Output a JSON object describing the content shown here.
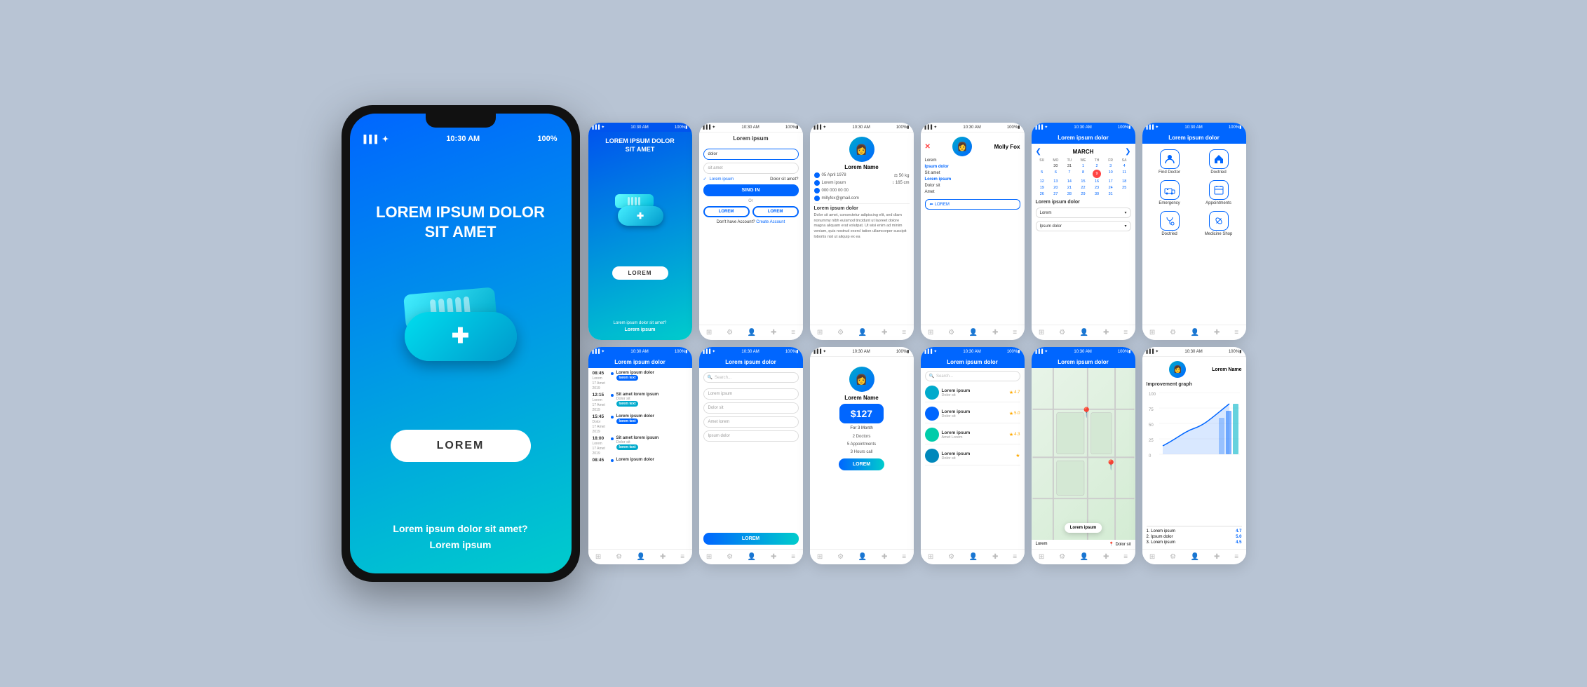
{
  "bg": "#b8c4d4",
  "bigPhone": {
    "status": {
      "signal": "▌▌▌",
      "wifi": "wifi",
      "time": "10:30 AM",
      "battery": "100%"
    },
    "title": "LOREM IPSUM DOLOR\nSIT AMET",
    "button": "LOREM",
    "footer": "Lorem ipsum dolor sit amet?",
    "footerLink": "Lorem ipsum"
  },
  "phones": [
    {
      "id": "phone1",
      "type": "splash",
      "statusTime": "10:30 AM",
      "statusBattery": "100%",
      "title": "LOREM IPSUM DOLOR SIT AMET",
      "button": "LOREM",
      "footer": "Lorem ipsum dolor sit amet?",
      "footerLink": "Lorem ipsum"
    },
    {
      "id": "phone2",
      "type": "login",
      "statusTime": "10:30 AM",
      "headerTitle": "Lorem ipsum",
      "inputs": [
        "dolor",
        "sit amet"
      ],
      "checkLabel": "Lorem ipsum",
      "checkRight": "Dolor sit amet?",
      "signinBtn": "SING IN",
      "or": "Or",
      "socialBtns": [
        "LOREM",
        "LOREM"
      ],
      "footerText": "Don't have Account?",
      "footerLink": "Create Account"
    },
    {
      "id": "phone3",
      "type": "profile",
      "statusTime": "10:30 AM",
      "name": "Lorem Name",
      "dob": "05 April 1978",
      "weight": "50 kg",
      "height": "165 cm",
      "phone": "000 000 00 00",
      "email": "millyfox@gmail.com",
      "sectionTitle": "Lorem ipsum dolor",
      "desc": "Dolor sit amet, consectetur adipiscing elit, sed diam nonummy nibh euismod tincidunt ut laoreet dolore magna aliquam erat volutpat. Ut wisi enim ad minim veniam, quis nostrud exercl tation ullamcorper suscipit lobortis nisl ut aliquip ex ea"
    },
    {
      "id": "phone4",
      "type": "chat",
      "statusTime": "10:30 AM",
      "name": "Molly Fox",
      "items": [
        "Lorem",
        "Ipsum dolor",
        "Sit amet",
        "Lorem ipsum",
        "Dolor sit",
        "Amet"
      ],
      "logoutLabel": "LOREM"
    },
    {
      "id": "phone5",
      "type": "calendar",
      "statusTime": "10:30 AM",
      "headerTitle": "Lorem ipsum dolor",
      "month": "MARCH",
      "days": [
        "SU",
        "MO",
        "TU",
        "WE",
        "TH",
        "FR",
        "SA"
      ],
      "dates": [
        [
          "",
          "30",
          "31",
          "1",
          "2",
          "3",
          "4",
          "5"
        ],
        [
          "6",
          "7",
          "8",
          "9",
          "10",
          "11",
          "12"
        ],
        [
          "13",
          "14",
          "15",
          "16",
          "17",
          "18",
          "19"
        ],
        [
          "20",
          "21",
          "22",
          "23",
          "24",
          "25",
          "26"
        ],
        [
          "27",
          "28",
          "29",
          "30",
          "31",
          "",
          ""
        ]
      ],
      "today": "9",
      "dropdown1": "Lorem",
      "dropdown2": "Ipsum dolor",
      "sectionTitle": "Lorem ipsum dolor"
    },
    {
      "id": "phone6",
      "type": "icons",
      "statusTime": "10:30 AM",
      "headerTitle": "Lorem ipsum dolor",
      "icons": [
        {
          "icon": "👨‍⚕️",
          "label": "Find Doctor"
        },
        {
          "icon": "🏠",
          "label": "Doctried"
        },
        {
          "icon": "🚑",
          "label": "Emergency"
        },
        {
          "icon": "📋",
          "label": "Appointments"
        },
        {
          "icon": "💊",
          "label": "Doctried"
        },
        {
          "icon": "💊",
          "label": "Medicine Shop"
        }
      ]
    },
    {
      "id": "phone7",
      "type": "schedule",
      "statusTime": "10:30 AM",
      "headerTitle": "Lorem ipsum dolor",
      "schedule": [
        {
          "time": "08:45",
          "sub": "Lorem\n17 Amet 2019",
          "desc": "Lorem ipsum dolor",
          "badge": "blue"
        },
        {
          "time": "12:15",
          "sub": "Lorem\n17 Amet 2019",
          "desc": "Sit amet lorem ipsum\nDolor sit",
          "badge": "teal"
        },
        {
          "time": "15:45",
          "sub": "Dolor\n17 Amet 2019",
          "desc": "Lorem ipsum dolor",
          "badge": "blue"
        },
        {
          "time": "18:00",
          "sub": "Lorem\n17 Amet 2019",
          "desc": "Sit amet lorem ipsum\nDolor sit",
          "badge": "teal"
        },
        {
          "time": "08:45",
          "sub": "",
          "desc": "Lorem ipsum dolor",
          "badge": ""
        }
      ]
    },
    {
      "id": "phone8",
      "type": "form",
      "statusTime": "10:30 AM",
      "headerTitle": "Lorem ipsum dolor",
      "searchPlaceholder": "Search...",
      "fields": [
        "Lorem ipsum",
        "Dolor sit",
        "Amet lorem",
        "Ipsum dolor"
      ],
      "button": "LOREM"
    },
    {
      "id": "phone9",
      "type": "pricing",
      "statusTime": "10:30 AM",
      "avatarName": "Lorem Name",
      "price": "$127",
      "period": "For 3 Month",
      "feature1": "2 Doctors",
      "feature2": "5 Appointments",
      "feature3": "3 Hours call",
      "button": "LOREM"
    },
    {
      "id": "phone10",
      "type": "doctorlist",
      "statusTime": "10:30 AM",
      "headerTitle": "Lorem ipsum dolor",
      "searchPlaceholder": "Search...",
      "doctors": [
        {
          "name": "Lorem ipsum",
          "spec": "Dolor sit",
          "rating": "4.7"
        },
        {
          "name": "Lorem ipsum",
          "spec": "Dolor sit",
          "rating": "5.0"
        },
        {
          "name": "Lorem ipsum",
          "spec": "Amet Lorem",
          "rating": "4.3"
        },
        {
          "name": "Lorem ipsum",
          "spec": "Dolor sit",
          "rating": ""
        }
      ]
    },
    {
      "id": "phone11",
      "type": "map",
      "statusTime": "10:30 AM",
      "headerTitle": "Lorem ipsum dolor",
      "userName": "Lorem",
      "badgeLabel": "Lorem ipsum",
      "subLabel": "Dolor sit"
    },
    {
      "id": "phone12",
      "type": "graph",
      "statusTime": "10:30 AM",
      "avatarName": "Lorem Name",
      "graphTitle": "Improvement graph",
      "yLabels": [
        "100",
        "75",
        "50",
        "25",
        "0"
      ],
      "legends": [
        {
          "label": "1. Lorem ipsum",
          "value": "4.7"
        },
        {
          "label": "2. Ipsum dolor",
          "value": "5.0"
        },
        {
          "label": "3. Lorem ipsum",
          "value": "4.5"
        }
      ]
    }
  ],
  "navIcons": [
    "⊞",
    "⚙",
    "👤",
    "+",
    "≡"
  ]
}
